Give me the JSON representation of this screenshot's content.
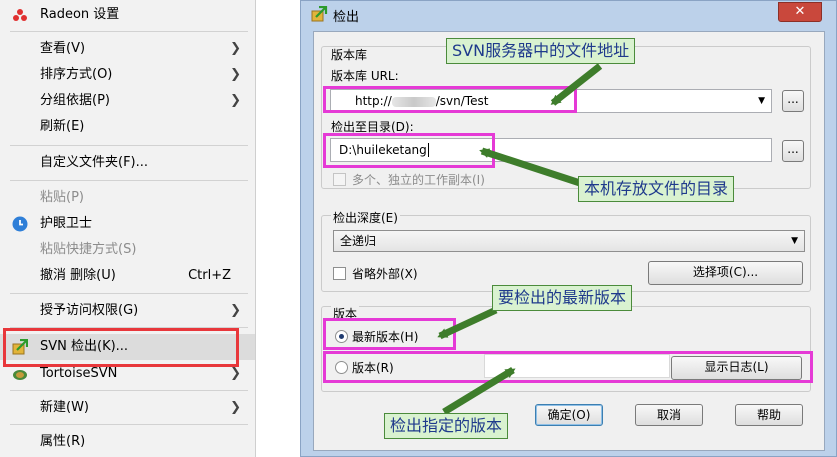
{
  "context_menu": {
    "items": [
      {
        "label": "Radeon 设置",
        "icon": "radeon-icon"
      },
      {
        "label": "查看(V)"
      },
      {
        "label": "排序方式(O)"
      },
      {
        "label": "分组依据(P)"
      },
      {
        "label": "刷新(E)"
      },
      {
        "label": "自定义文件夹(F)..."
      },
      {
        "label": "粘贴(P)"
      },
      {
        "label": "护眼卫士",
        "icon": "eye-guard-icon"
      },
      {
        "label": "粘贴快捷方式(S)"
      },
      {
        "label": "撤消 删除(U)",
        "shortcut": "Ctrl+Z"
      },
      {
        "label": "授予访问权限(G)"
      },
      {
        "label": "SVN 检出(K)...",
        "icon": "svn-checkout-icon"
      },
      {
        "label": "TortoiseSVN",
        "icon": "tortoisesvn-icon"
      },
      {
        "label": "新建(W)"
      },
      {
        "label": "属性(R)"
      }
    ]
  },
  "dialog": {
    "title": "检出",
    "close_label": "✕",
    "repo_group_label": "版本库",
    "repo_url_label": "版本库 URL:",
    "repo_url_value_prefix": "http://",
    "repo_url_value_suffix": "/svn/Test",
    "browse_label": "...",
    "checkout_dir_label": "检出至目录(D):",
    "checkout_dir_value": "D:\\huileketang",
    "multi_wc_label": "多个、独立的工作副本(I)",
    "depth_label": "检出深度(E)",
    "depth_value": "全递归",
    "omit_externals_label": "省略外部(X)",
    "choose_items_label": "选择项(C)...",
    "revision_group_label": "版本",
    "head_revision_label": "最新版本(H)",
    "revision_label": "版本(R)",
    "show_log_label": "显示日志(L)",
    "ok_label": "确定(O)",
    "cancel_label": "取消",
    "help_label": "帮助"
  },
  "annotations": {
    "svn_address": "SVN服务器中的文件地址",
    "local_dir": "本机存放文件的目录",
    "latest_version": "要检出的最新版本",
    "specific_version": "检出指定的版本"
  },
  "colors": {
    "menu_highlight_box": "#e8373b",
    "annotation_box": "#e53ad6",
    "callout_bg": "#d9f2d0",
    "callout_text": "#1f3a8c",
    "arrow": "#3e7d2b",
    "dialog_frame": "#bcd1ea"
  }
}
